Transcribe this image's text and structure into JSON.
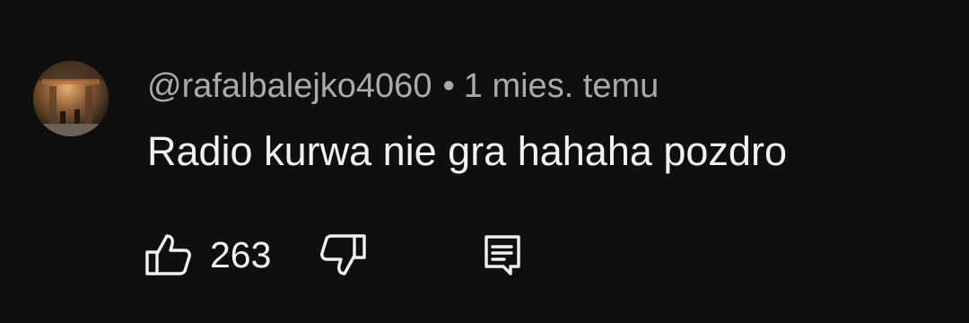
{
  "comment": {
    "author": "@rafalbalejko4060",
    "separator": "•",
    "timestamp": "1 mies. temu",
    "text": "Radio kurwa nie gra hahaha pozdro",
    "like_count": "263"
  },
  "icons": {
    "avatar": "avatar-image",
    "like": "thumbs-up-icon",
    "dislike": "thumbs-down-icon",
    "reply": "reply-comment-icon"
  },
  "colors": {
    "background": "#0f0f0f",
    "primary_text": "#f1f1f1",
    "secondary_text": "#aaaaaa"
  }
}
